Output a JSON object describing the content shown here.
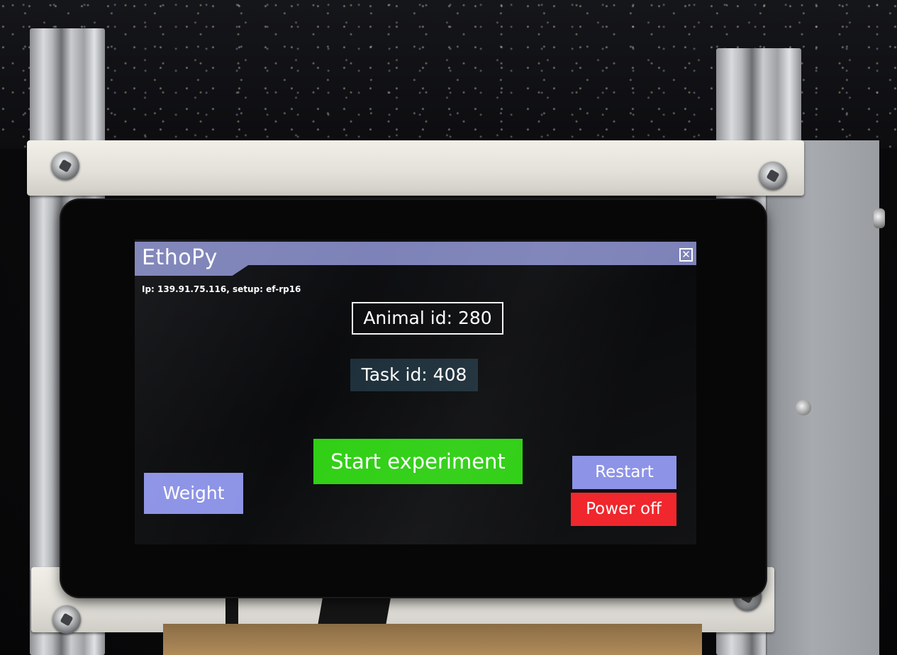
{
  "window": {
    "title": "EthoPy",
    "close_symbol": "✕"
  },
  "status": {
    "info": "Ip: 139.91.75.116, setup: ef-rp16"
  },
  "fields": {
    "animal_id": "Animal id: 280",
    "task_id": "Task id: 408"
  },
  "buttons": {
    "start": "Start experiment",
    "weight": "Weight",
    "restart": "Restart",
    "power_off": "Power off"
  },
  "colors": {
    "title_bar": "#7d82b8",
    "start_button": "#2fcf14",
    "secondary_button": "#8d93e6",
    "power_button": "#f0272d",
    "task_field_bg": "#1d2f3a"
  }
}
